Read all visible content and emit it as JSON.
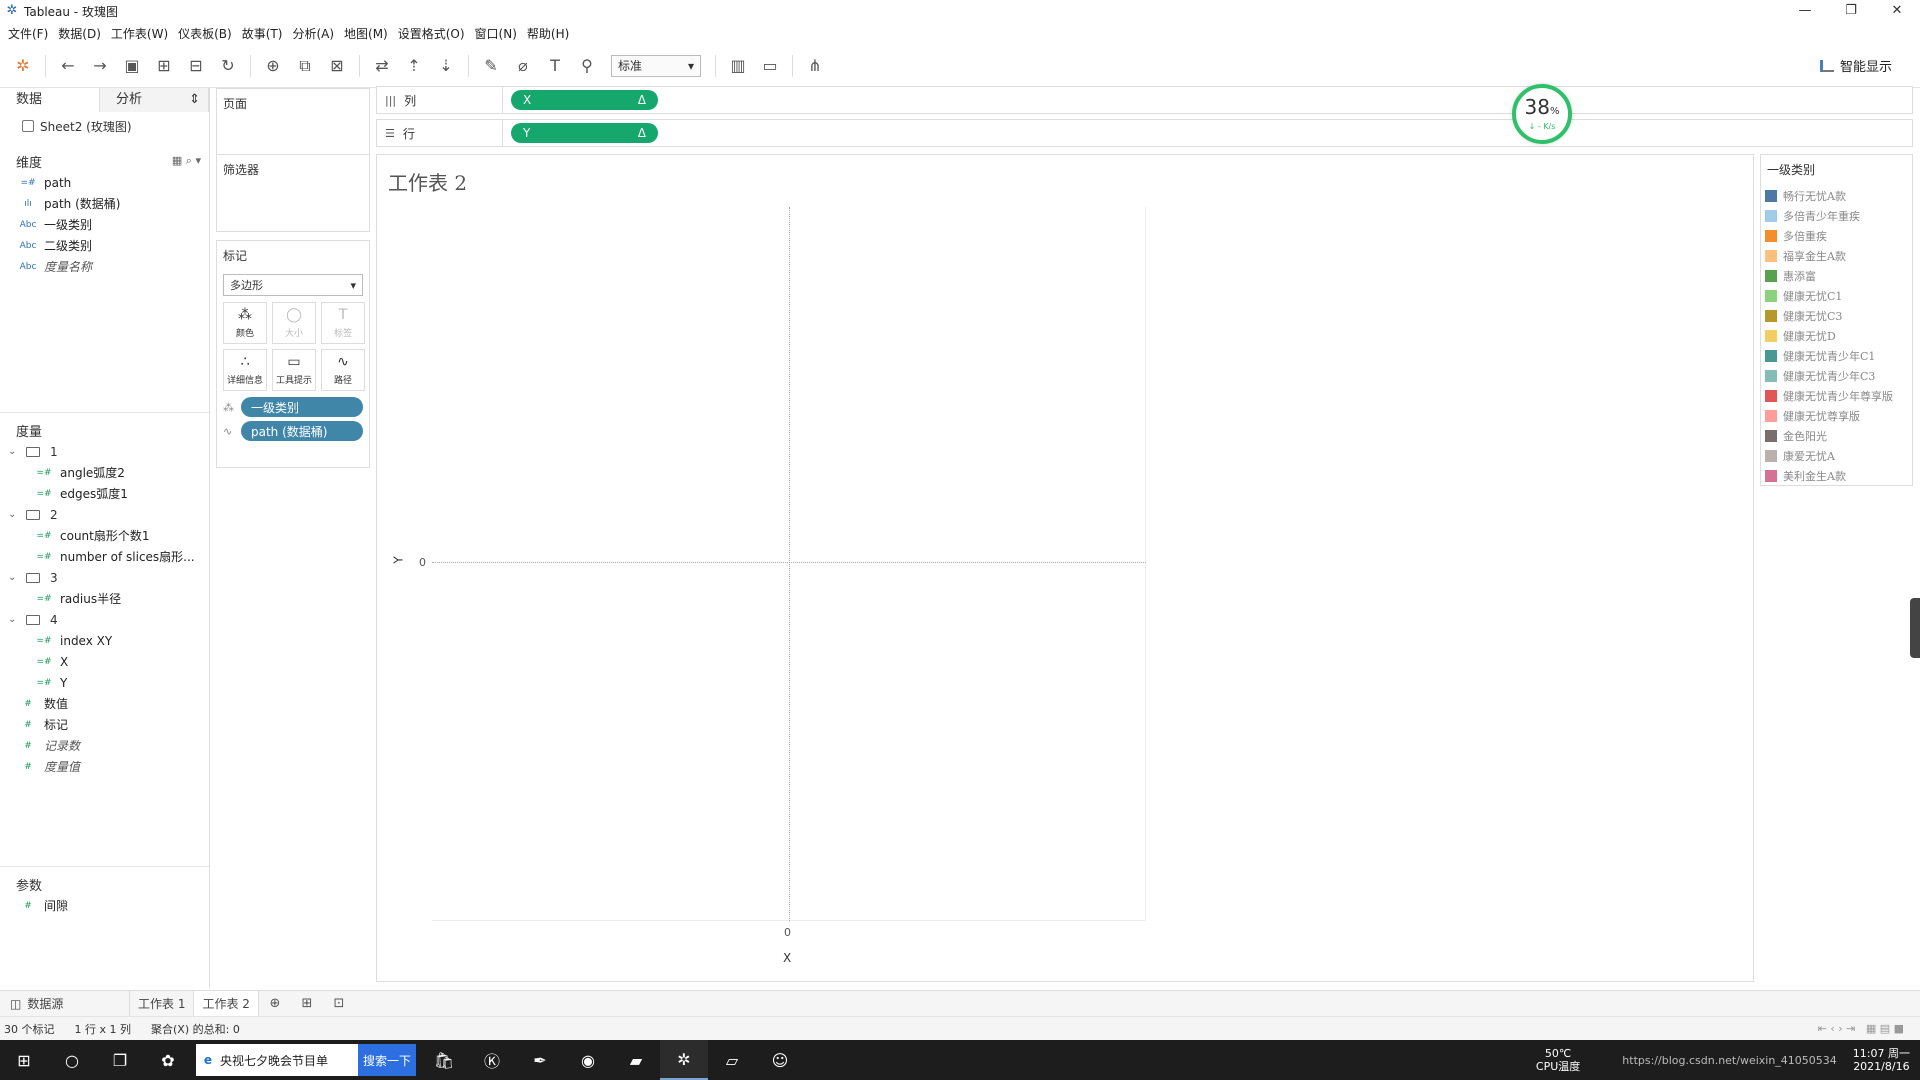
{
  "window": {
    "title": "Tableau - 玫瑰图",
    "controls": [
      "—",
      "❐",
      "✕"
    ]
  },
  "menu": [
    "文件(F)",
    "数据(D)",
    "工作表(W)",
    "仪表板(B)",
    "故事(T)",
    "分析(A)",
    "地图(M)",
    "设置格式(O)",
    "窗口(N)",
    "帮助(H)"
  ],
  "toolbar": {
    "fit_select": "标准",
    "smart_show": "智能显示"
  },
  "left_pane": {
    "tab_data": "数据",
    "tab_analysis": "分析",
    "datasource": "Sheet2 (玫瑰图)",
    "dimensions_title": "维度",
    "dimensions": [
      {
        "type": "=#",
        "label": "path",
        "italic": false
      },
      {
        "type": "ılı",
        "label": "path (数据桶)",
        "italic": false
      },
      {
        "type": "Abc",
        "label": "一级类别",
        "italic": false
      },
      {
        "type": "Abc",
        "label": "二级类别",
        "italic": false
      },
      {
        "type": "Abc",
        "label": "度量名称",
        "italic": true
      }
    ],
    "measures_title": "度量",
    "folders": [
      {
        "name": "1",
        "fields": [
          "angle弧度2",
          "edges弧度1"
        ]
      },
      {
        "name": "2",
        "fields": [
          "count扇形个数1",
          "number of slices扇形..."
        ]
      },
      {
        "name": "3",
        "fields": [
          "radius半径"
        ]
      },
      {
        "name": "4",
        "fields": [
          "index XY",
          "X",
          "Y"
        ]
      }
    ],
    "loose_measures": [
      {
        "label": "数值",
        "italic": false
      },
      {
        "label": "标记",
        "italic": false
      },
      {
        "label": "记录数",
        "italic": true
      },
      {
        "label": "度量值",
        "italic": true
      }
    ],
    "params_title": "参数",
    "params": [
      "间隙"
    ]
  },
  "cards": {
    "pages": "页面",
    "filters": "筛选器",
    "marks": "标记",
    "mark_type": "多边形",
    "mark_buttons": [
      {
        "icon": "⁂",
        "label": "颜色",
        "enabled": true
      },
      {
        "icon": "◯",
        "label": "大小",
        "enabled": false
      },
      {
        "icon": "T",
        "label": "标签",
        "enabled": false
      },
      {
        "icon": "∴",
        "label": "详细信息",
        "enabled": true
      },
      {
        "icon": "▭",
        "label": "工具提示",
        "enabled": true
      },
      {
        "icon": "∿",
        "label": "路径",
        "enabled": true
      }
    ],
    "mark_pills": [
      {
        "icon": "⁂",
        "label": "一级类别"
      },
      {
        "icon": "∿",
        "label": "path (数据桶)"
      }
    ]
  },
  "shelves": {
    "columns_label": "列",
    "columns_pill": "X",
    "rows_label": "行",
    "rows_pill": "Y",
    "pill_delta": "Δ"
  },
  "speed_widget": {
    "percent": "38",
    "unit": "%",
    "rate": "↓ - K/s"
  },
  "view": {
    "title": "工作表 2",
    "y_label": "Y",
    "y_tick": "0",
    "x_tick": "0",
    "x_label": "X"
  },
  "legend": {
    "title": "一级类别",
    "items": [
      {
        "label": "畅行无忧A款",
        "color": "#4e79a7"
      },
      {
        "label": "多倍青少年重疾",
        "color": "#a0cbe8"
      },
      {
        "label": "多倍重疾",
        "color": "#f28e2b"
      },
      {
        "label": "福享金生A款",
        "color": "#ffbe7d"
      },
      {
        "label": "惠添富",
        "color": "#59a14f"
      },
      {
        "label": "健康无忧C1",
        "color": "#8cd17d"
      },
      {
        "label": "健康无忧C3",
        "color": "#b6992d"
      },
      {
        "label": "健康无忧D",
        "color": "#f1ce63"
      },
      {
        "label": "健康无忧青少年C1",
        "color": "#499894"
      },
      {
        "label": "健康无忧青少年C3",
        "color": "#86bcb6"
      },
      {
        "label": "健康无忧青少年尊享版",
        "color": "#e15759"
      },
      {
        "label": "健康无忧尊享版",
        "color": "#ff9d9a"
      },
      {
        "label": "金色阳光",
        "color": "#79706e"
      },
      {
        "label": "康爱无忧A",
        "color": "#bab0ac"
      },
      {
        "label": "美利金生A款",
        "color": "#d37295"
      }
    ]
  },
  "sheet_tabs": {
    "datasource": "数据源",
    "sheets": [
      "工作表 1",
      "工作表 2"
    ],
    "active": 1
  },
  "status": {
    "marks": "30 个标记",
    "grid": "1 行 x 1 列",
    "sum": "聚合(X) 的总和: 0"
  },
  "taskbar": {
    "search_text": "央视七夕晚会节目单",
    "search_button": "搜索一下",
    "temp": "50℃",
    "cpu": "CPU温度",
    "time": "11:07 周一",
    "date": "2021/8/16",
    "watermark": "https://blog.csdn.net/weixin_41050534"
  }
}
